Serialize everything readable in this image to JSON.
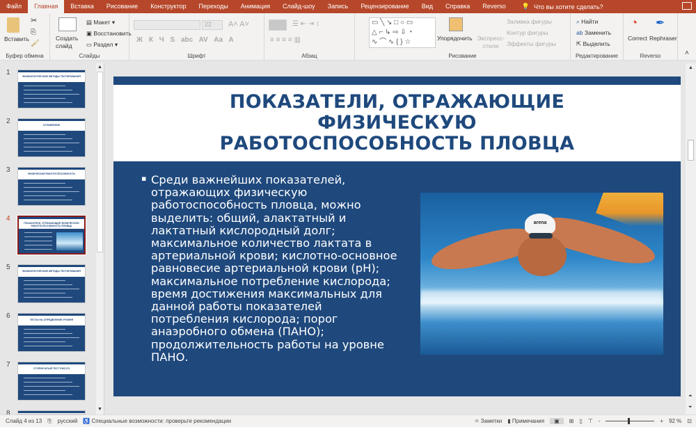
{
  "ribbon_tabs": [
    "Файл",
    "Главная",
    "Вставка",
    "Рисование",
    "Конструктор",
    "Переходы",
    "Анимация",
    "Слайд-шоу",
    "Запись",
    "Рецензирование",
    "Вид",
    "Справка",
    "Reverso"
  ],
  "tell_me": "Что вы хотите сделать?",
  "clipboard": {
    "paste": "Вставить",
    "label": "Буфер обмена"
  },
  "slides_group": {
    "new_slide": "Создать слайд",
    "layout": "Макет",
    "reset": "Восстановить",
    "section": "Раздел",
    "label": "Слайды"
  },
  "font": {
    "size": "22",
    "bold": "Ж",
    "italic": "К",
    "underline": "Ч",
    "shadow": "S",
    "strike": "abc",
    "spacing": "AV",
    "case": "Aa",
    "color": "A",
    "label": "Шрифт"
  },
  "paragraph": {
    "label": "Абзац"
  },
  "drawing": {
    "arrange": "Упорядочить",
    "styles": "Экспресс-стили",
    "fill": "Заливка фигуры",
    "outline": "Контур фигуры",
    "effects": "Эффекты фигуры",
    "label": "Рисование"
  },
  "editing": {
    "find": "Найти",
    "replace": "Заменить",
    "select": "Выделить",
    "label": "Редактирование"
  },
  "reverso": {
    "correct": "Correct",
    "rephraser": "Rephraser",
    "label": "Reverso"
  },
  "thumbnails": [
    {
      "num": "1",
      "title": "ФИЗИОЛОГИЧЕСКИЕ МЕТОДЫ ТЕСТИРОВАНИЯ"
    },
    {
      "num": "2",
      "title": "ОГЛАВЛЕНИЕ"
    },
    {
      "num": "3",
      "title": "ФИЗИЧЕСКАЯ РАБОТОСПОСОБНОСТЬ"
    },
    {
      "num": "4",
      "title": "ПОКАЗАТЕЛИ, ОТРАЖАЮЩИЕ ФИЗИЧЕСКУЮ РАБОТОСПОСОБНОСТЬ ПЛОВЦА"
    },
    {
      "num": "5",
      "title": "ФИЗИОЛОГИЧЕСКИЕ МЕТОДЫ ТЕСТИРОВАНИЯ"
    },
    {
      "num": "6",
      "title": "ТЕСТЫ НА ОПРЕДЕЛЕНИЕ УРОВНЯ"
    },
    {
      "num": "7",
      "title": "СТУПЕНЧАТЫЙ ТЕСТ PWC170"
    },
    {
      "num": "8",
      "title": ""
    }
  ],
  "slide": {
    "title": "ПОКАЗАТЕЛИ, ОТРАЖАЮЩИЕ ФИЗИЧЕСКУЮ РАБОТОСПОСОБНОСТЬ ПЛОВЦА",
    "bullet": "Среди важнейших показателей, отражающих физическую работоспособность пловца, можно выделить: общий, алактатный и лактатный кислородный долг; максимальное количество лактата в артериальной крови; кислотно-основное равновесие артериальной крови (pH); максимальное потребление кислорода; время достижения максимальных для данной работы показателей потребления кислорода; порог анаэробного обмена (ПАНО); продолжительность работы на уровне ПАНО.",
    "cap_text": "arena"
  },
  "status": {
    "slide": "Слайд 4 из 13",
    "lang": "русский",
    "accessibility": "Специальные возможности: проверьте рекомендации",
    "notes": "Заметки",
    "comments": "Примечания",
    "zoom": "92 %",
    "zoom_minus": "-",
    "zoom_plus": "+"
  },
  "colors": {
    "accent": "#b7472a",
    "slide_blue": "#1f497d"
  }
}
